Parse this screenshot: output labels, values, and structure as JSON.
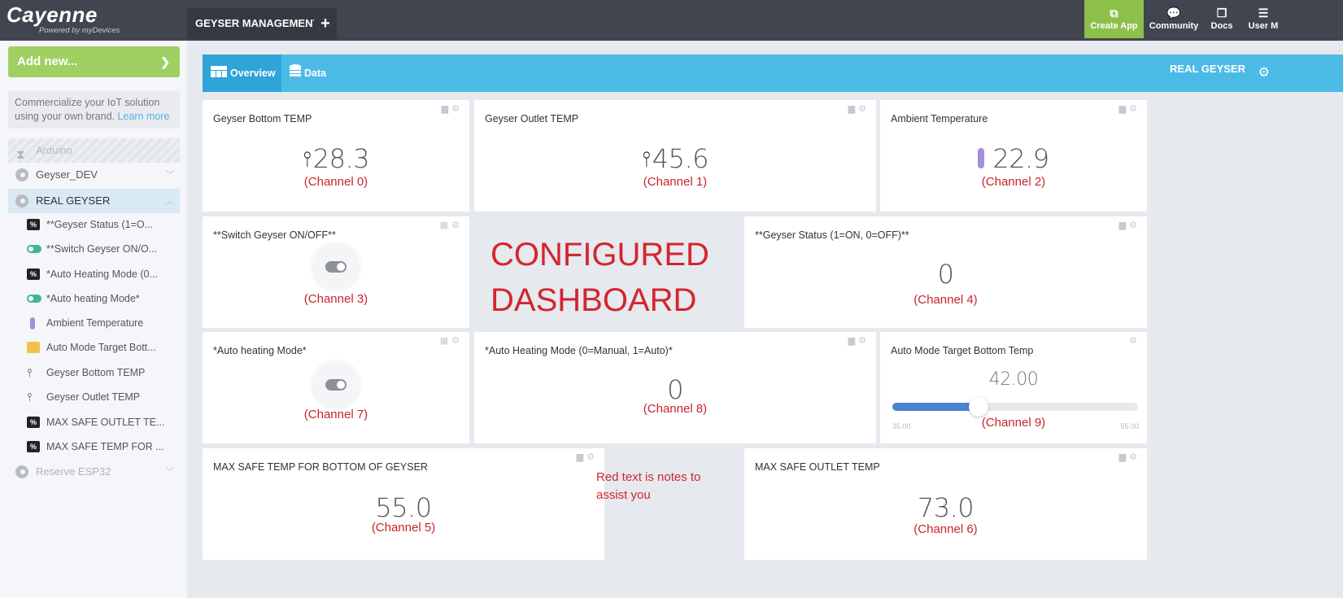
{
  "app": {
    "brand": "Cayenne",
    "tagline": "Powered by myDevices"
  },
  "topbar": {
    "dashboard_tab": "GEYSER MANAGEMENT",
    "add_tab": "+",
    "nav": [
      {
        "label": "Create App",
        "icon": "create-app-icon"
      },
      {
        "label": "Community",
        "icon": "chat-icon"
      },
      {
        "label": "Docs",
        "icon": "docs-icon"
      },
      {
        "label": "User M",
        "icon": "menu-icon"
      }
    ]
  },
  "sidebar": {
    "add_new": "Add new...",
    "promo_text": "Commercialize your IoT solution using your own brand.",
    "promo_link": "Learn more",
    "devices": [
      {
        "name": "Arduino",
        "state": "disabled"
      },
      {
        "name": "Geyser_DEV",
        "state": "collapsed"
      },
      {
        "name": "REAL GEYSER",
        "state": "expanded"
      },
      {
        "name": "Reserve ESP32",
        "state": "collapsed"
      }
    ],
    "widgets": [
      {
        "label": "**Geyser Status (1=O...",
        "icon": "generic-value-icon"
      },
      {
        "label": "**Switch Geyser ON/O...",
        "icon": "toggle-icon"
      },
      {
        "label": "*Auto Heating Mode (0...",
        "icon": "generic-value-icon"
      },
      {
        "label": "*Auto heating Mode*",
        "icon": "toggle-icon"
      },
      {
        "label": "Ambient Temperature",
        "icon": "thermometer-icon"
      },
      {
        "label": "Auto Mode Target Bott...",
        "icon": "slider-icon"
      },
      {
        "label": "Geyser Bottom TEMP",
        "icon": "temperature-probe-icon"
      },
      {
        "label": "Geyser Outlet TEMP",
        "icon": "temperature-probe-icon"
      },
      {
        "label": "MAX SAFE OUTLET TE...",
        "icon": "generic-value-icon"
      },
      {
        "label": "MAX SAFE TEMP FOR ...",
        "icon": "generic-value-icon"
      }
    ]
  },
  "main": {
    "tabs": [
      {
        "label": "Overview",
        "active": true
      },
      {
        "label": "Data",
        "active": false
      }
    ],
    "device_name": "REAL GEYSER",
    "widgets": {
      "bottom_temp": {
        "title": "Geyser Bottom TEMP",
        "value": "28.3",
        "note": "(Channel 0)"
      },
      "outlet_temp": {
        "title": "Geyser Outlet TEMP",
        "value": "45.6",
        "note": "(Channel 1)"
      },
      "ambient_temp": {
        "title": "Ambient Temperature",
        "value": "22.9",
        "note": "(Channel 2)"
      },
      "switch_geyser": {
        "title": "**Switch Geyser ON/OFF**",
        "state": "off",
        "note": "(Channel 3)"
      },
      "geyser_status": {
        "title": "**Geyser Status (1=ON, 0=OFF)**",
        "value": "0",
        "note": "(Channel 4)"
      },
      "auto_heating_toggle": {
        "title": "*Auto heating Mode*",
        "state": "off",
        "note": "(Channel 7)"
      },
      "auto_heating_mode": {
        "title": "*Auto Heating Mode (0=Manual, 1=Auto)*",
        "value": "0",
        "note": "(Channel 8)"
      },
      "target_temp": {
        "title": "Auto Mode Target Bottom Temp",
        "value": "42.00",
        "min": "35.00",
        "max": "55.00",
        "fraction": 0.35,
        "note": "(Channel 9)"
      },
      "max_bottom": {
        "title": "MAX SAFE TEMP FOR BOTTOM OF GEYSER",
        "value": "55.0",
        "note": "(Channel 5)"
      },
      "max_outlet": {
        "title": "MAX SAFE OUTLET TEMP",
        "value": "73.0",
        "note": "(Channel 6)"
      }
    },
    "annotations": {
      "configured_line1": "CONFIGURED",
      "configured_line2": "DASHBOARD",
      "notes_text": "Red text is notes to assist you"
    },
    "colors": {
      "accent_blue": "#4bbbe6",
      "accent_green": "#8dc04a",
      "note_red": "#d32530"
    }
  }
}
